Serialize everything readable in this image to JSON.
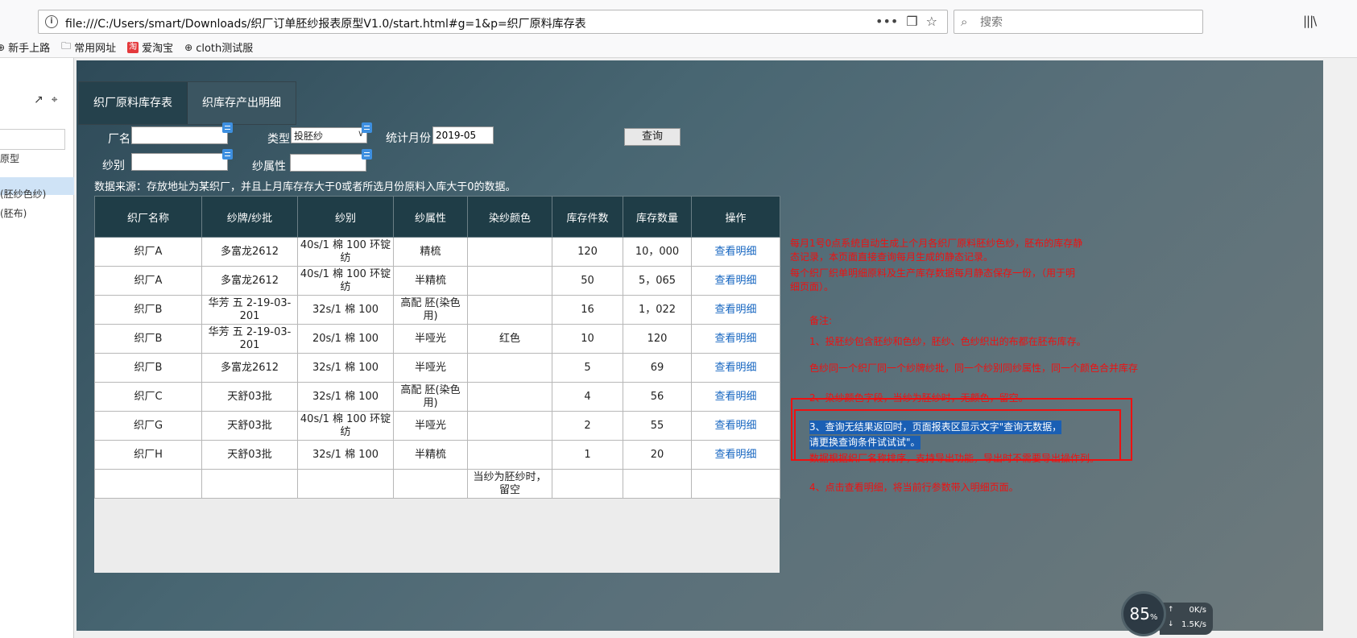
{
  "browser": {
    "url": "file:///C:/Users/smart/Downloads/织厂订单胚纱报表原型V1.0/start.html#g=1&p=织厂原料库存表",
    "search_placeholder": "搜索",
    "bookmarks": [
      "新手上路",
      "常用网址",
      "爱淘宝",
      "cloth测试服"
    ],
    "taobao_glyph": "淘"
  },
  "sidebar": {
    "items": [
      "原型",
      "(胚纱色纱)",
      "(胚布)"
    ]
  },
  "tabs": [
    "织厂原料库存表",
    "织库存产出明细"
  ],
  "filters": {
    "factory_label": "厂名",
    "type_label": "类型",
    "type_value": "投胚纱",
    "month_label": "统计月份",
    "month_value": "2019-05",
    "yarn_label": "纱别",
    "attr_label": "纱属性",
    "query_label": "查询"
  },
  "datasource_note": "数据来源：存放地址为某织厂，并且上月库存存大于0或者所选月份原料入库大于0的数据。",
  "table": {
    "headers": [
      "织厂名称",
      "纱牌/纱批",
      "纱别",
      "纱属性",
      "染纱颜色",
      "库存件数",
      "库存数量",
      "操作"
    ],
    "rows": [
      [
        "织厂A",
        "多富龙2612",
        "40s/1 棉 100 环锭纺",
        "精梳",
        "",
        "120",
        "10，000",
        "查看明细"
      ],
      [
        "织厂A",
        "多富龙2612",
        "40s/1 棉 100 环锭纺",
        "半精梳",
        "",
        "50",
        "5，065",
        "查看明细"
      ],
      [
        "织厂B",
        "华芳 五 2-19-03-201",
        "32s/1 棉 100",
        "高配 胚(染色用)",
        "",
        "16",
        "1，022",
        "查看明细"
      ],
      [
        "织厂B",
        "华芳 五 2-19-03-201",
        "20s/1 棉 100",
        "半哑光",
        "红色",
        "10",
        "120",
        "查看明细"
      ],
      [
        "织厂B",
        "多富龙2612",
        "32s/1 棉 100",
        "半哑光",
        "",
        "5",
        "69",
        "查看明细"
      ],
      [
        "织厂C",
        "天舒03批",
        "32s/1 棉 100",
        "高配 胚(染色用)",
        "",
        "4",
        "56",
        "查看明细"
      ],
      [
        "织厂G",
        "天舒03批",
        "40s/1 棉 100 环锭纺",
        "半哑光",
        "",
        "2",
        "55",
        "查看明细"
      ],
      [
        "织厂H",
        "天舒03批",
        "32s/1 棉 100",
        "半精梳",
        "",
        "1",
        "20",
        "查看明细"
      ]
    ],
    "blank_row_color_note": "当纱为胚纱时，留空"
  },
  "notes": {
    "n1a": "每月1号0点系统自动生成上个月各织厂原料胚纱色纱，胚布的库存静",
    "n1b": "态记录，本页面直接查询每月生成的静态记录。",
    "n2a": "每个织厂织单明细原料及生产库存数据每月静态保存一份，（用于明",
    "n2b": "细页面）。",
    "remark": "备注:",
    "r1": "1、投胚纱包含胚纱和色纱，胚纱、色纱织出的布都在胚布库存。",
    "r2": "色纱同一个织厂同一个纱牌纱批，同一个纱别同纱属性，同一个颜色合并库存",
    "r3": "2、染纱颜色字段，当纱为胚纱时，无颜色，留空。",
    "r4a": "3、查询无结果返回时，页面报表区显示文字\"查询无数据，",
    "r4b": "请更换查询条件试试试\"。",
    "r5": "数据根据织厂名称排序，支持导出功能，导出时不需要导出操作列。",
    "r6": "4、点击查看明细，将当前行参数带入明细页面。"
  },
  "net_widget": {
    "percent": "85",
    "percent_unit": "%",
    "up": "0K/s",
    "down": "1.5K/s"
  }
}
